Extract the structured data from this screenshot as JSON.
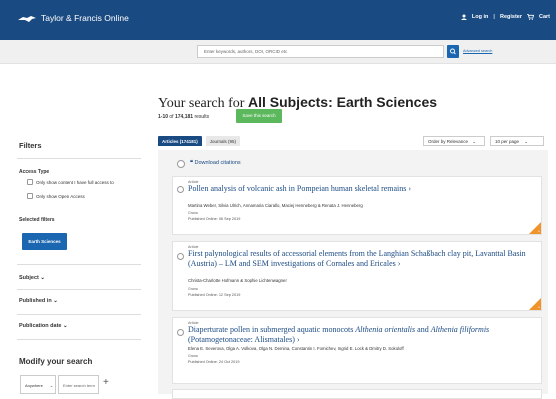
{
  "header": {
    "logo": "Taylor & Francis Online",
    "login": "Log in",
    "separator": "|",
    "register": "Register",
    "cart": "Cart"
  },
  "search": {
    "placeholder": "Enter keywords, authors, DOI, ORCID etc",
    "advanced": "Advanced search"
  },
  "results": {
    "heading_prefix": "Your search for ",
    "heading_query": "All Subjects: Earth Sciences",
    "range": "1-10",
    "of": "of",
    "total": "174,181",
    "results_word": "results",
    "save_label": "Save this search"
  },
  "filters": {
    "title": "Filters",
    "access_type": "Access Type",
    "full_access": "Only show content I have full access to",
    "open_access": "Only show Open Access",
    "selected_filters": "Selected filters",
    "selected_chip": "Earth Sciences",
    "subject": "Subject",
    "published_in": "Published in",
    "publication_date": "Publication date",
    "modify": "Modify your search",
    "anywhere": "Anywhere",
    "term_placeholder": "Enter search term"
  },
  "tabs": [
    {
      "label": "Articles (174181)"
    },
    {
      "label": "Journals (95)"
    }
  ],
  "sort": {
    "value": "Order by Relevance"
  },
  "per_page": {
    "value": "10 per page"
  },
  "download_citations": "Download citations",
  "articles": [
    {
      "type": "Article",
      "title": "Pollen analysis of volcanic ash in Pompeian human skeletal remains",
      "authors": "Martina Weber, Silvia Ulrich, Annamaria Ciarallo, Maciej Henneberg & Renata J. Henneberg",
      "journal": "Grana",
      "published": "Published Online: 06 Sep 2019",
      "open_access": true
    },
    {
      "type": "Article",
      "title": "First palynological results of accessorial elements from the Langhian Schaßbach clay pit, Lavanttal Basin (Austria) – LM and SEM investigations of Cornales and Ericales",
      "authors": "Christa-Charlotte Hofmann & Sophie Lichtenwagner",
      "journal": "Grana",
      "published": "Published Online: 12 Sep 2019",
      "open_access": true
    },
    {
      "type": "Article",
      "title_part1": "Diaperturate pollen in submerged aquatic monocots ",
      "title_italic1": "Althenia orientalis",
      "title_part2": " and ",
      "title_italic2": "Althenia filiformis",
      "title_part3": " (Potamogetonaceae: Alismatales)",
      "authors": "Elena E. Severova, Olga A. Volkova, Olga N. Demina, Constantin I. Fomichev, Ingrid E. Lock & Dmitry D. Sokoloff",
      "journal": "Grana",
      "published": "Published Online: 24 Oct 2019",
      "open_access": false
    }
  ],
  "colors": {
    "brand": "#1a4a82",
    "save": "#5cb85c",
    "open_access": "#f0932b"
  }
}
